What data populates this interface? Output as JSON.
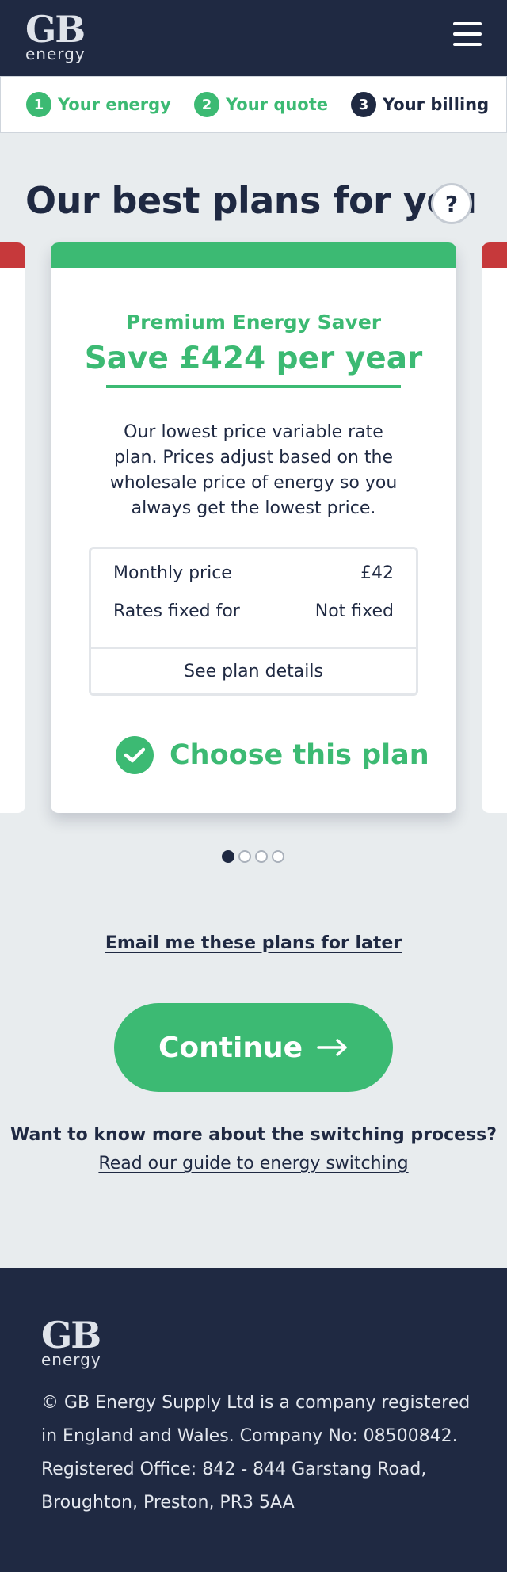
{
  "brand": {
    "logo_main": "GB",
    "logo_sub": "energy"
  },
  "header": {
    "menu_icon": "hamburger-menu-icon"
  },
  "steps": [
    {
      "number": "1",
      "label": "Your energy",
      "state": "done"
    },
    {
      "number": "2",
      "label": "Your quote",
      "state": "done"
    },
    {
      "number": "3",
      "label": "Your billing",
      "state": "active"
    }
  ],
  "page": {
    "title": "Our best plans for you",
    "help_label": "?"
  },
  "plan": {
    "name": "Premium Energy Saver",
    "saving": "Save £424 per year",
    "description": "Our lowest price variable rate plan. Prices adjust based on the wholesale price of energy so you always get the lowest price.",
    "rows": [
      {
        "label": "Monthly price",
        "value": "£42"
      },
      {
        "label": "Rates fixed for",
        "value": "Not fixed"
      }
    ],
    "details_link": "See plan details",
    "choose_label": "Choose this plan"
  },
  "carousel": {
    "total_slides": 4,
    "active_slide": 1
  },
  "actions": {
    "email_link": "Email me these plans for later",
    "continue_label": "Continue",
    "switch_question": "Want to know more about the switching process?",
    "guide_link": "Read our guide to energy switching"
  },
  "footer": {
    "text": "© GB Energy Supply Ltd is a company registered in England and Wales. Company No: 08500842. Registered Office: 842 - 844 Garstang Road, Broughton, Preston, PR3 5AA"
  },
  "colors": {
    "navy": "#1f2942",
    "green": "#3cba73",
    "red": "#c6393b",
    "background": "#e8ecee"
  }
}
